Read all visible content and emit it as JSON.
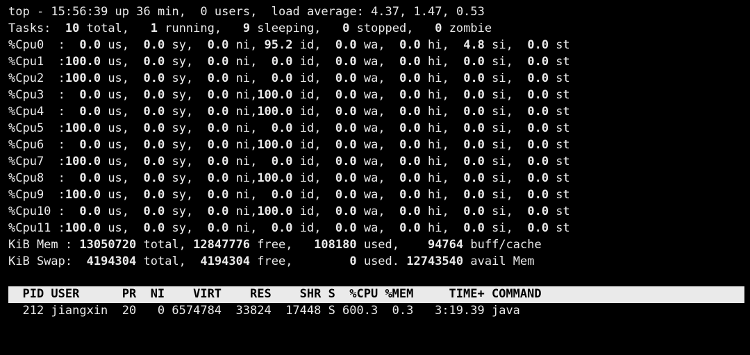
{
  "summary": {
    "time": "15:56:39",
    "uptime": "36 min",
    "users": "0",
    "load": {
      "1": "4.37",
      "5": "1.47",
      "15": "0.53"
    }
  },
  "tasks": {
    "total": "10",
    "running": "1",
    "sleeping": "9",
    "stopped": "0",
    "zombie": "0"
  },
  "cpus": [
    {
      "label": "%Cpu0 ",
      "us": "  0.0",
      "sy": "  0.0",
      "ni": "  0.0",
      "id": " 95.2",
      "wa": "  0.0",
      "hi": "  0.0",
      "si": "  4.8",
      "st": "  0.0"
    },
    {
      "label": "%Cpu1 ",
      "us": "100.0",
      "sy": "  0.0",
      "ni": "  0.0",
      "id": "  0.0",
      "wa": "  0.0",
      "hi": "  0.0",
      "si": "  0.0",
      "st": "  0.0"
    },
    {
      "label": "%Cpu2 ",
      "us": "100.0",
      "sy": "  0.0",
      "ni": "  0.0",
      "id": "  0.0",
      "wa": "  0.0",
      "hi": "  0.0",
      "si": "  0.0",
      "st": "  0.0"
    },
    {
      "label": "%Cpu3 ",
      "us": "  0.0",
      "sy": "  0.0",
      "ni": "  0.0",
      "id": "100.0",
      "wa": "  0.0",
      "hi": "  0.0",
      "si": "  0.0",
      "st": "  0.0"
    },
    {
      "label": "%Cpu4 ",
      "us": "  0.0",
      "sy": "  0.0",
      "ni": "  0.0",
      "id": "100.0",
      "wa": "  0.0",
      "hi": "  0.0",
      "si": "  0.0",
      "st": "  0.0"
    },
    {
      "label": "%Cpu5 ",
      "us": "100.0",
      "sy": "  0.0",
      "ni": "  0.0",
      "id": "  0.0",
      "wa": "  0.0",
      "hi": "  0.0",
      "si": "  0.0",
      "st": "  0.0"
    },
    {
      "label": "%Cpu6 ",
      "us": "  0.0",
      "sy": "  0.0",
      "ni": "  0.0",
      "id": "100.0",
      "wa": "  0.0",
      "hi": "  0.0",
      "si": "  0.0",
      "st": "  0.0"
    },
    {
      "label": "%Cpu7 ",
      "us": "100.0",
      "sy": "  0.0",
      "ni": "  0.0",
      "id": "  0.0",
      "wa": "  0.0",
      "hi": "  0.0",
      "si": "  0.0",
      "st": "  0.0"
    },
    {
      "label": "%Cpu8 ",
      "us": "  0.0",
      "sy": "  0.0",
      "ni": "  0.0",
      "id": "100.0",
      "wa": "  0.0",
      "hi": "  0.0",
      "si": "  0.0",
      "st": "  0.0"
    },
    {
      "label": "%Cpu9 ",
      "us": "100.0",
      "sy": "  0.0",
      "ni": "  0.0",
      "id": "  0.0",
      "wa": "  0.0",
      "hi": "  0.0",
      "si": "  0.0",
      "st": "  0.0"
    },
    {
      "label": "%Cpu10",
      "us": "  0.0",
      "sy": "  0.0",
      "ni": "  0.0",
      "id": "100.0",
      "wa": "  0.0",
      "hi": "  0.0",
      "si": "  0.0",
      "st": "  0.0"
    },
    {
      "label": "%Cpu11",
      "us": "100.0",
      "sy": "  0.0",
      "ni": "  0.0",
      "id": "  0.0",
      "wa": "  0.0",
      "hi": "  0.0",
      "si": "  0.0",
      "st": "  0.0"
    }
  ],
  "mem": {
    "label": "KiB Mem :",
    "total": "13050720",
    "free": "12847776",
    "used": "  108180",
    "buff": "   94764",
    "buff_label": "buff/cache"
  },
  "swap": {
    "label": "KiB Swap:",
    "total": " 4194304",
    "free": " 4194304",
    "used": "       0",
    "avail": "12743540",
    "avail_label": "avail Mem"
  },
  "table": {
    "header": "  PID USER      PR  NI    VIRT    RES    SHR S  %CPU %MEM     TIME+ COMMAND                    ",
    "rows": [
      {
        "pid": "  212",
        "user": "jiangxin",
        "pr": "20",
        "ni": "  0",
        "virt": "6574784",
        "res": " 33824",
        "shr": " 17448",
        "s": "S",
        "cpu": "600.3",
        "mem": " 0.3",
        "time": "  3:19.39",
        "cmd": "java"
      }
    ]
  }
}
